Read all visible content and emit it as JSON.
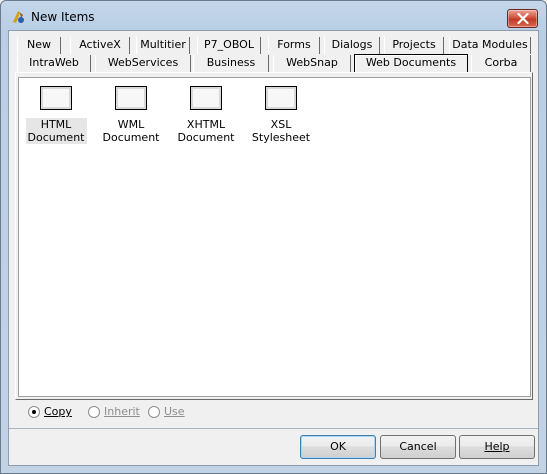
{
  "window": {
    "title": "New Items",
    "app_icon": "delphi-icon",
    "close_icon": "close-icon"
  },
  "tabs": {
    "row1": [
      "New",
      "ActiveX",
      "Multitier",
      "P7_OBOL",
      "Forms",
      "Dialogs",
      "Projects",
      "Data Modules"
    ],
    "row2": [
      "IntraWeb",
      "WebServices",
      "Business",
      "WebSnap",
      "Web Documents",
      "Corba"
    ],
    "active": "Web Documents"
  },
  "items": [
    {
      "line1": "HTML",
      "line2": "Document",
      "icon": "document-icon",
      "selected": true
    },
    {
      "line1": "WML",
      "line2": "Document",
      "icon": "document-icon",
      "selected": false
    },
    {
      "line1": "XHTML",
      "line2": "Document",
      "icon": "document-icon",
      "selected": false
    },
    {
      "line1": "XSL",
      "line2": "Stylesheet",
      "icon": "document-icon",
      "selected": false
    }
  ],
  "options": {
    "copy": {
      "label": "Copy",
      "checked": true,
      "enabled": true
    },
    "inherit": {
      "label": "Inherit",
      "checked": false,
      "enabled": false
    },
    "use": {
      "label": "Use",
      "checked": false,
      "enabled": false
    }
  },
  "buttons": {
    "ok": "OK",
    "cancel": "Cancel",
    "help": "Help"
  },
  "colors": {
    "close_button": "#c23b22",
    "titlebar": "#c3d6ea"
  }
}
